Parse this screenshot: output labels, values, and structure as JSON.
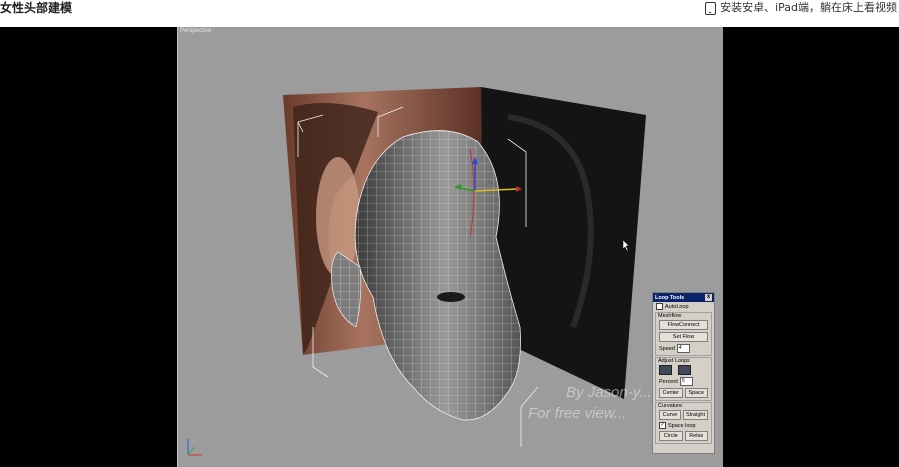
{
  "page": {
    "title": "女性头部建模"
  },
  "promo": {
    "icon": "tablet-icon",
    "text": "安装安卓、iPad端，躺在床上看视频"
  },
  "viewport": {
    "label": "Perspective"
  },
  "watermark": {
    "line1": "By Jason-y...",
    "line2": "For free view..."
  },
  "loop_tools": {
    "title": "Loop Tools",
    "close": "x",
    "autoloop_label": "AutoLoop",
    "autoloop_checked": false,
    "meshflow_label": "Meshflow",
    "flowconnect": "FlowConnect",
    "setflow": "Set Flow",
    "speed_label": "Speed",
    "speed_value": "4",
    "adjust_loops_label": "Adjust Loops",
    "percent_label": "Percent",
    "percent_value": "5",
    "center": "Center",
    "space": "Space",
    "curvature_label": "Curvature",
    "curve": "Curve",
    "straight": "Straight",
    "spaceloop_label": "Space loop",
    "spaceloop_checked": true,
    "circle": "Circle",
    "relax": "Relax"
  },
  "colors": {
    "viewport_bg": "#9c9c9c",
    "panel_header": "#0a246a",
    "player_bg": "#000000"
  }
}
